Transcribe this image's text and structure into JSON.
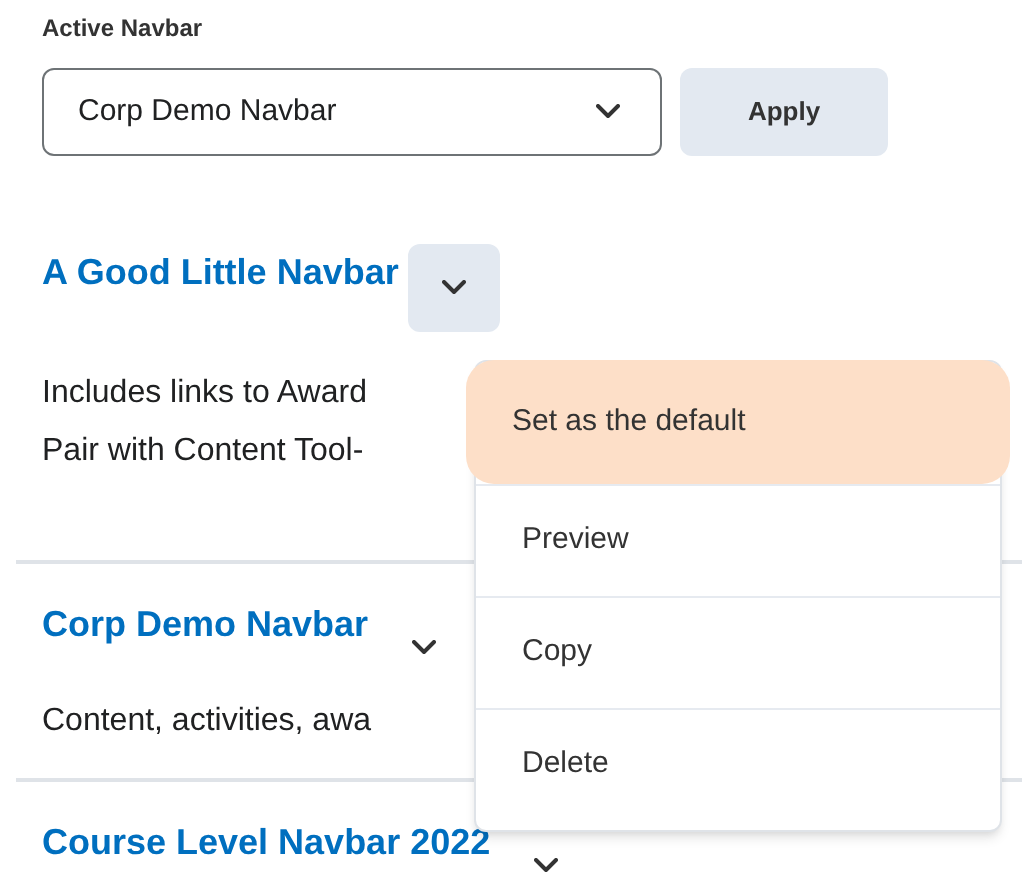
{
  "active_navbar": {
    "label": "Active Navbar",
    "value": "Corp Demo Navbar",
    "apply": "Apply"
  },
  "navbars": [
    {
      "title": "A Good Little Navbar",
      "menu_open": true,
      "description": [
        "Includes links to Award",
        "Pair with Content Tool-"
      ]
    },
    {
      "title": "Corp Demo Navbar",
      "menu_open": false,
      "description": [
        "Content, activities, awa"
      ]
    },
    {
      "title": "Course Level Navbar 2022",
      "menu_open": false
    }
  ],
  "menu": [
    {
      "label": "Set as the default",
      "selected": true
    },
    {
      "label": "Preview",
      "selected": false
    },
    {
      "label": "Copy",
      "selected": false
    },
    {
      "label": "Delete",
      "selected": false
    }
  ]
}
